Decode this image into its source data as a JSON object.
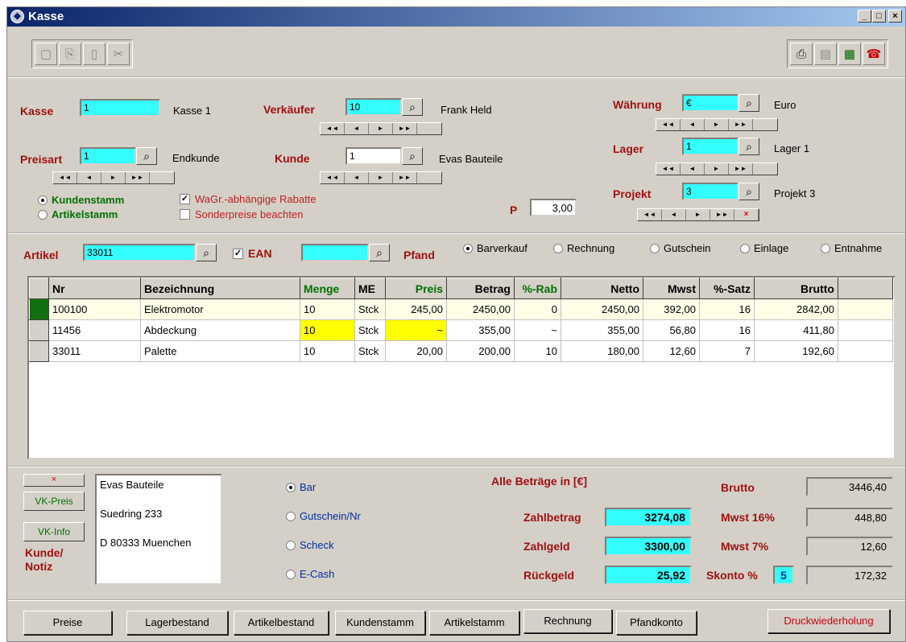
{
  "window": {
    "title": "Kasse",
    "buttons": {
      "minimize": "_",
      "maximize": "□",
      "close": "×"
    }
  },
  "header": {
    "kasse": {
      "label": "Kasse",
      "value": "1",
      "name": "Kasse 1"
    },
    "verkaeufer": {
      "label": "Verkäufer",
      "value": "10",
      "name": "Frank Held"
    },
    "waehrung": {
      "label": "Währung",
      "value": "€",
      "name": "Euro"
    },
    "preisart": {
      "label": "Preisart",
      "value": "1",
      "name": "Endkunde"
    },
    "kunde": {
      "label": "Kunde",
      "value": "1",
      "name": "Evas Bauteile"
    },
    "lager": {
      "label": "Lager",
      "value": "1",
      "name": "Lager 1"
    },
    "projekt": {
      "label": "Projekt",
      "value": "3",
      "name": "Projekt 3"
    },
    "radio_kundenstamm": "Kundenstamm",
    "radio_artikelstamm": "Artikelstamm",
    "chk_rabatte": "WaGr.-abhängige Rabatte",
    "chk_sonderpreise": "Sonderpreise beachten",
    "p_label": "P",
    "p_value": "3,00",
    "nav": {
      "first": "◄◄",
      "prev": "◄",
      "next": "►",
      "last": "►►",
      "del": "×"
    }
  },
  "artikel": {
    "label": "Artikel",
    "value": "33011",
    "ean_label": "EAN",
    "ean_value": "",
    "pfand": "Pfand",
    "modes": [
      "Barverkauf",
      "Rechnung",
      "Gutschein",
      "Einlage",
      "Entnahme"
    ]
  },
  "table": {
    "headers": [
      "Nr",
      "Bezeichnung",
      "Menge",
      "ME",
      "Preis",
      "Betrag",
      "%-Rab",
      "Netto",
      "Mwst",
      "%-Satz",
      "Brutto"
    ],
    "rows": [
      [
        "100100",
        "Elektromotor",
        "10",
        "Stck",
        "245,00",
        "2450,00",
        "0",
        "2450,00",
        "392,00",
        "16",
        "2842,00"
      ],
      [
        "11456",
        "Abdeckung",
        "10",
        "Stck",
        "~",
        "355,00",
        "~",
        "355,00",
        "56,80",
        "16",
        "411,80"
      ],
      [
        "33011",
        "Palette",
        "10",
        "Stck",
        "20,00",
        "200,00",
        "10",
        "180,00",
        "12,60",
        "7",
        "192,60"
      ]
    ]
  },
  "bottom": {
    "x": "×",
    "vk_preis": "VK-Preis",
    "vk_info": "VK-Info",
    "kunde_notiz": "Kunde/\nNotiz",
    "address": [
      "Evas Bauteile",
      "Suedring 233",
      "D 80333 Muenchen"
    ],
    "pay": [
      "Bar",
      "Gutschein/Nr",
      "Scheck",
      "E-Cash"
    ],
    "alle": "Alle Beträge in [€]",
    "zahlbetrag": {
      "label": "Zahlbetrag",
      "value": "3274,08"
    },
    "zahlgeld": {
      "label": "Zahlgeld",
      "value": "3300,00"
    },
    "rueckgeld": {
      "label": "Rückgeld",
      "value": "25,92"
    },
    "brutto": {
      "label": "Brutto",
      "value": "3446,40"
    },
    "mwst16": {
      "label": "Mwst 16%",
      "value": "448,80"
    },
    "mwst7": {
      "label": "Mwst 7%",
      "value": "12,60"
    },
    "skonto": {
      "label": "Skonto %",
      "pct": "5",
      "value": "172,32"
    }
  },
  "footer": [
    "Preise",
    "Lagerbestand",
    "Artikelbestand",
    "Kundenstamm",
    "Artikelstamm",
    "Rechnung",
    "Pfandkonto",
    "Druckwiederholung"
  ]
}
